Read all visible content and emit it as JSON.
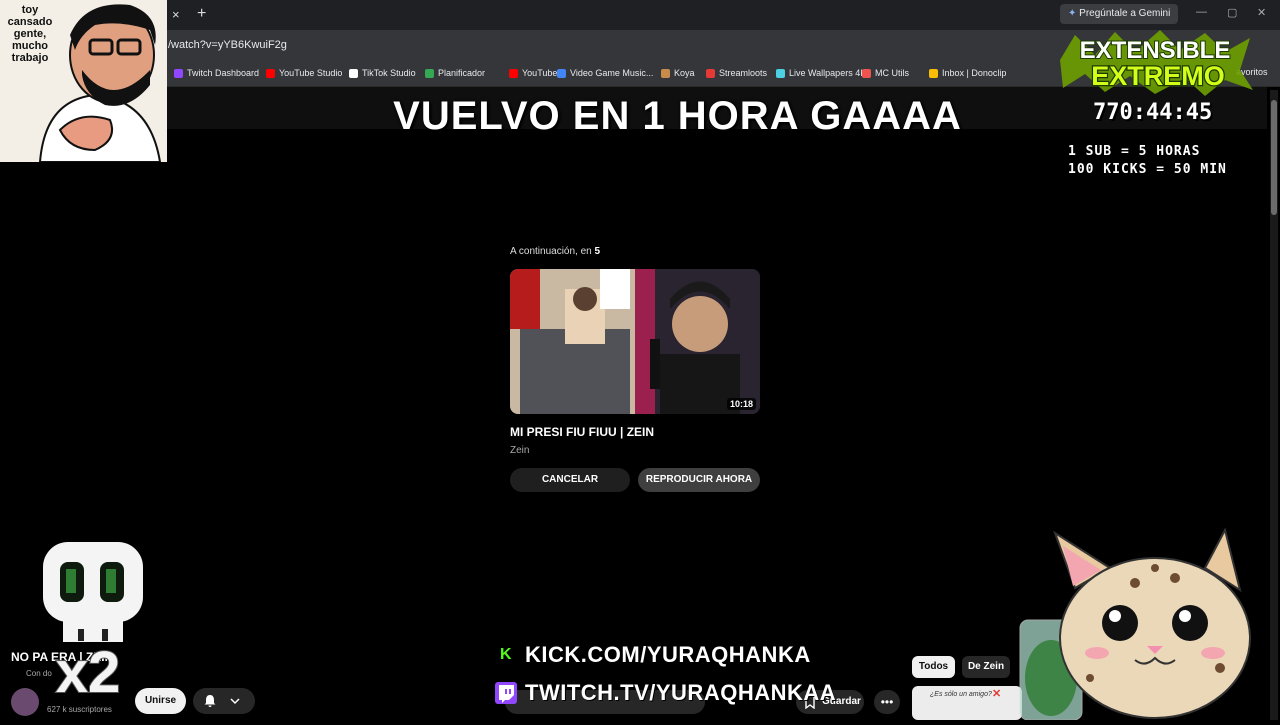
{
  "browser": {
    "tab_close": "×",
    "new_tab": "+",
    "url": "/watch?v=yYB6KwuiF2g",
    "gemini": "Pregúntale a Gemini",
    "window_controls": [
      "—",
      "▢",
      "✕"
    ],
    "favorites": "avoritos",
    "bookmarks": [
      {
        "label": "Twitch Dashboard",
        "color": "#9146ff"
      },
      {
        "label": "YouTube Studio",
        "color": "#ff0000"
      },
      {
        "label": "TikTok Studio",
        "color": "#ffffff"
      },
      {
        "label": "Planificador",
        "color": "#34a853"
      },
      {
        "label": "YouTube",
        "color": "#ff0000"
      },
      {
        "label": "Video Game Music...",
        "color": "#4285f4"
      },
      {
        "label": "Koya",
        "color": "#c98b4a"
      },
      {
        "label": "Streamloots",
        "color": "#e53935"
      },
      {
        "label": "Live Wallpapers 4K",
        "color": "#4dd0e1"
      },
      {
        "label": "MC Utils",
        "color": "#ef5350"
      },
      {
        "label": "Inbox | Donoclip",
        "color": "#fbbc05"
      }
    ]
  },
  "overlay": {
    "banner": "VUELVO EN 1 HORA GAAAA",
    "avatar_caption": "toy cansado gente, mucho trabajo",
    "timer": "770:44:45",
    "rules": [
      "1 SUB = 5 HORAS",
      "100 KICKS = 50 MIN"
    ],
    "extensible_line1": "EXTENSIBLE",
    "extensible_line2": "EXTREMO",
    "kick": "KICK.COM/YURAQHANKA",
    "twitch": "TWITCH.TV/YURAQHANKAA",
    "kick_logo": "K",
    "multiplier": "x2"
  },
  "up_next": {
    "prefix": "A continuación, en ",
    "count": "5",
    "title": "MI PRESI FIU FIUU | ZEIN",
    "channel": "Zein",
    "duration": "10:18",
    "cancel": "CANCELAR",
    "play_now": "REPRODUCIR AHORA"
  },
  "video_info": {
    "title": "NO PA         ERA | ZEIN",
    "subtitle": "Con do",
    "subscribers": "627 k suscriptores",
    "join": "Unirse",
    "save": "Guardar",
    "more": "•••",
    "chip_all": "Todos",
    "chip_zein": "De Zein",
    "related_caption": "¿Es sólo un amigo?"
  },
  "colors": {
    "kick": "#53fc18",
    "twitch": "#9146ff",
    "extensible": "#c6ff00"
  }
}
